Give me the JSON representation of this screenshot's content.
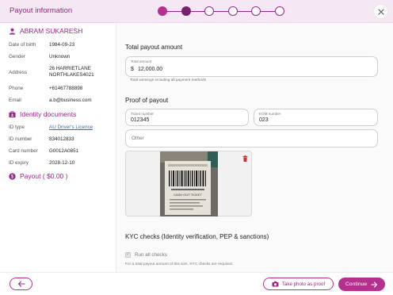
{
  "header": {
    "title": "Payout information",
    "steps": [
      "done",
      "current",
      "todo",
      "todo",
      "todo",
      "todo"
    ],
    "close_icon": "close-icon"
  },
  "customer": {
    "icon": "person-icon",
    "name": "ABRAM SUKARESH",
    "rows": [
      {
        "label": "Date of birth",
        "value": "1984-09-23"
      },
      {
        "label": "Gender",
        "value": "Unknown"
      },
      {
        "label": "Address",
        "value": "26 HARRIETLANE NORTHLAKES4021"
      },
      {
        "label": "Phone",
        "value": "+61467788898"
      },
      {
        "label": "Email",
        "value": "a.b@business.com"
      }
    ]
  },
  "identity": {
    "icon": "id-card-icon",
    "heading": "Identity documents",
    "rows": [
      {
        "label": "ID type",
        "value": "AU Driver's Licence"
      },
      {
        "label": "ID number",
        "value": "834012833"
      },
      {
        "label": "Card number",
        "value": "G0012A0851"
      },
      {
        "label": "ID expiry",
        "value": "2028-12-10"
      }
    ]
  },
  "payout": {
    "icon": "dollar-circle-icon",
    "heading": "Payout ( $0.00 )"
  },
  "total": {
    "heading": "Total payout amount",
    "field_label": "Total amount",
    "currency": "$",
    "value": "12,000.00",
    "hint": "Total winnings including all payment methods"
  },
  "proof": {
    "heading": "Proof of payout",
    "ticket_label": "Ticket number",
    "ticket_value": "012345",
    "egm_label": "EGM number",
    "egm_value": "023",
    "other_placeholder": "Other",
    "photo_caption": "CASH OUT TICKET"
  },
  "kyc": {
    "heading": "KYC checks (Identity verification, PEP & sanctions)",
    "checkbox_label": "Run all checks",
    "checked": true,
    "note": "For a total payout amount of this size, KYC checks are required."
  },
  "footer": {
    "back_icon": "arrow-left-icon",
    "photo_label": "Take photo as proof",
    "photo_icon": "camera-icon",
    "continue_label": "Continue",
    "continue_icon": "arrow-right-icon"
  },
  "colors": {
    "accent": "#b5308f",
    "accent_dark": "#7a1f6e",
    "header_bg": "#f6e7f4",
    "link": "#2f6fb0"
  }
}
